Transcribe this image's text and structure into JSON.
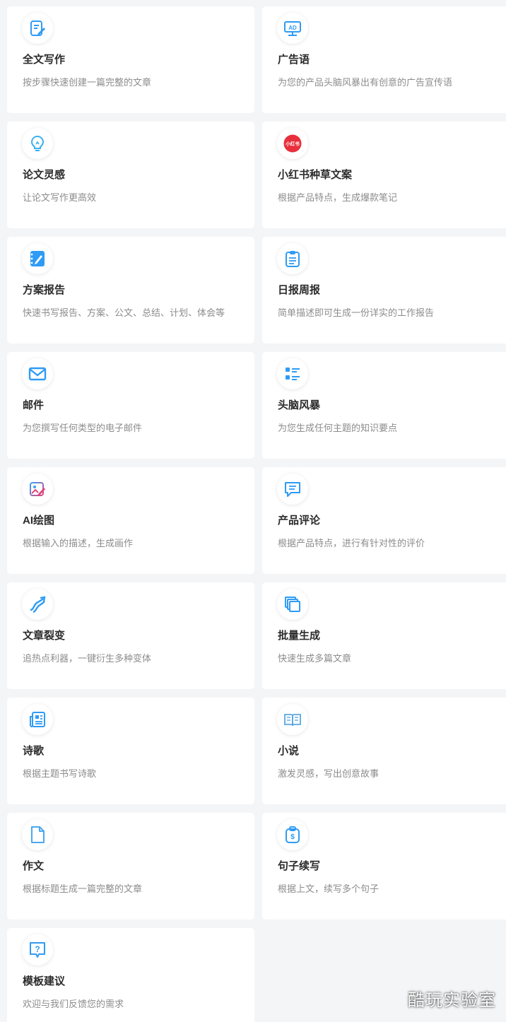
{
  "accent_color": "#2f9bf4",
  "cards": [
    {
      "title": "全文写作",
      "desc": "按步骤快速创建一篇完整的文章",
      "icon": "edit-document-icon"
    },
    {
      "title": "广告语",
      "desc": "为您的产品头脑风暴出有创意的广告宣传语",
      "icon": "ad-board-icon"
    },
    {
      "title": "论文灵感",
      "desc": "让论文写作更高效",
      "icon": "lightbulb-icon"
    },
    {
      "title": "小红书种草文案",
      "desc": "根据产品特点，生成爆款笔记",
      "icon": "xiaohongshu-logo-icon",
      "icon_text": "小红书"
    },
    {
      "title": "方案报告",
      "desc": "快速书写报告、方案、公文、总结、计划、体会等",
      "icon": "notebook-pen-icon"
    },
    {
      "title": "日报周报",
      "desc": "简单描述即可生成一份详实的工作报告",
      "icon": "clipboard-icon"
    },
    {
      "title": "邮件",
      "desc": "为您撰写任何类型的电子邮件",
      "icon": "envelope-icon"
    },
    {
      "title": "头脑风暴",
      "desc": "为您生成任何主题的知识要点",
      "icon": "checklist-icon"
    },
    {
      "title": "AI绘图",
      "desc": "根据输入的描述，生成画作",
      "icon": "image-brush-icon"
    },
    {
      "title": "产品评论",
      "desc": "根据产品特点，进行有针对性的评价",
      "icon": "comment-bubble-icon"
    },
    {
      "title": "文章裂变",
      "desc": "追热点利器，一键衍生多种变体",
      "icon": "split-arrows-icon"
    },
    {
      "title": "批量生成",
      "desc": "快速生成多篇文章",
      "icon": "stacked-pages-icon"
    },
    {
      "title": "诗歌",
      "desc": "根据主题书写诗歌",
      "icon": "newspaper-icon"
    },
    {
      "title": "小说",
      "desc": "激发灵感，写出创意故事",
      "icon": "open-book-icon"
    },
    {
      "title": "作文",
      "desc": "根据标题生成一篇完整的文章",
      "icon": "blank-page-icon"
    },
    {
      "title": "句子续写",
      "desc": "根据上文，续写多个句子",
      "icon": "clipboard-dollar-icon"
    },
    {
      "title": "模板建议",
      "desc": "欢迎与我们反馈您的需求",
      "icon": "question-bubble-icon"
    }
  ],
  "watermark": "酷玩实验室"
}
